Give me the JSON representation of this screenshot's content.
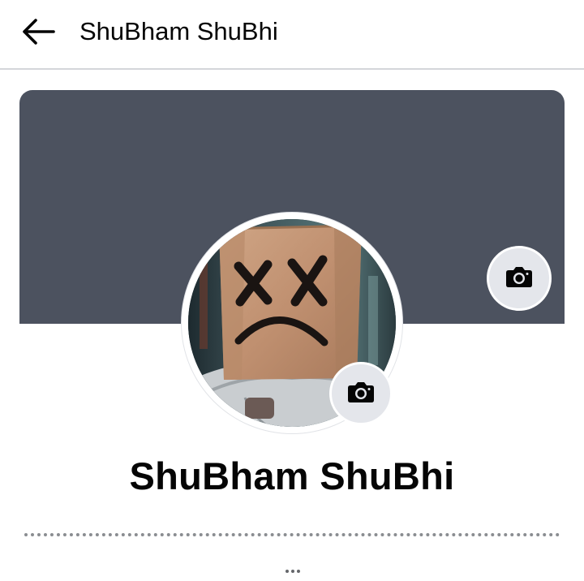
{
  "header": {
    "back_icon": "arrow-left-icon",
    "title": "ShuBham ShuBhi"
  },
  "cover": {
    "background_color": "#4c525f",
    "camera_icon": "camera-icon"
  },
  "avatar": {
    "description_icon": "paper-bag-face-icon",
    "camera_icon": "camera-icon"
  },
  "profile": {
    "name": "ShuBham ShuBhi"
  },
  "colors": {
    "text": "#050505",
    "divider": "#d4d6da",
    "button_bg": "#e4e6eb"
  }
}
